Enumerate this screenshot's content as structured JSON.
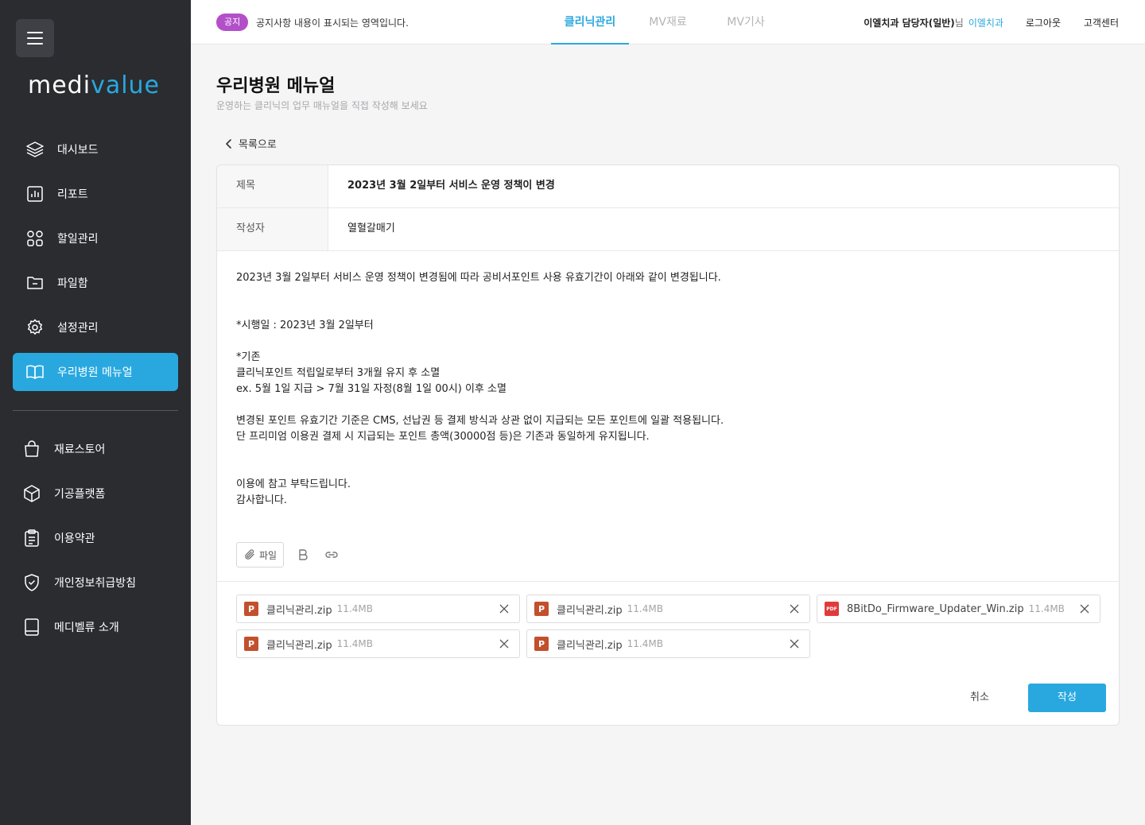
{
  "sidebar": {
    "logo_prefix": "medi",
    "logo_accent": "value",
    "menu": [
      {
        "label": "대시보드",
        "icon": "layers-icon"
      },
      {
        "label": "리포트",
        "icon": "chart-icon"
      },
      {
        "label": "할일관리",
        "icon": "grid-icon"
      },
      {
        "label": "파일함",
        "icon": "folder-icon"
      },
      {
        "label": "설정관리",
        "icon": "gear-icon"
      },
      {
        "label": "우리병원 메뉴얼",
        "icon": "book-icon",
        "active": true
      }
    ],
    "menu2": [
      {
        "label": "재료스토어",
        "icon": "bag-icon"
      },
      {
        "label": "기공플랫폼",
        "icon": "box-icon"
      },
      {
        "label": "이용약관",
        "icon": "clipboard-icon"
      },
      {
        "label": "개인정보취급방침",
        "icon": "shield-icon"
      },
      {
        "label": "메디벨류 소개",
        "icon": "notebook-icon"
      }
    ]
  },
  "header": {
    "notice_badge": "공지",
    "notice_text": "공지사항 내용이 표시되는 영역입니다.",
    "tabs": [
      "클리닉관리",
      "MV재료",
      "MV기사"
    ],
    "user_name": "이엘치과 담당자(일반)",
    "user_suffix": "님",
    "clinic_name": "이엘치과",
    "logout": "로그아웃",
    "support": "고객센터"
  },
  "page": {
    "title": "우리병원 메뉴얼",
    "subtitle": "운영하는 클리닉의 업무 매뉴얼을 직접 작성해 보세요",
    "back_label": "목록으로"
  },
  "form": {
    "title_label": "제목",
    "title_value": "2023년 3월 2일부터 서비스 운영 정책이 변경",
    "author_label": "작성자",
    "author_value": "열혈갈매기",
    "body_lines": [
      "2023년 3월 2일부터 서비스 운영 정책이 변경됨에 따라 공비서포인트 사용 유효기간이 아래와 같이 변경됩니다.",
      "",
      "",
      "*시행일 : 2023년 3월 2일부터",
      "",
      "*기존",
      "클리닉포인트 적립일로부터 3개월 유지 후 소멸",
      "ex. 5월 1일 지급 > 7월 31일 자정(8월 1일 00시) 이후 소멸",
      "",
      "변경된 포인트 유효기간 기준은 CMS, 선납권 등 결제 방식과 상관 없이 지급되는 모든 포인트에 일괄 적용됩니다.",
      "단 프리미엄 이용권 결제 시 지급되는 포인트 총액(30000점 등)은 기존과 동일하게 유지됩니다.",
      "",
      "",
      "이용에 참고 부탁드립니다.",
      "감사합니다."
    ],
    "file_button": "파일",
    "attachments": [
      {
        "type": "P",
        "name": "클리닉관리.zip",
        "size": "11.4MB"
      },
      {
        "type": "P",
        "name": "클리닉관리.zip",
        "size": "11.4MB"
      },
      {
        "type": "PDF",
        "name": "8BitDo_Firmware_Updater_Win.zip",
        "size": "11.4MB"
      },
      {
        "type": "P",
        "name": "클리닉관리.zip",
        "size": "11.4MB"
      },
      {
        "type": "P",
        "name": "클리닉관리.zip",
        "size": "11.4MB"
      }
    ],
    "cancel": "취소",
    "submit": "작성"
  },
  "colors": {
    "accent": "#29a8e0",
    "sidebar_bg": "#2b2c30",
    "notice_badge": "#b34fc9",
    "ppt_icon": "#c2502d",
    "pdf_icon": "#e03b3b"
  }
}
